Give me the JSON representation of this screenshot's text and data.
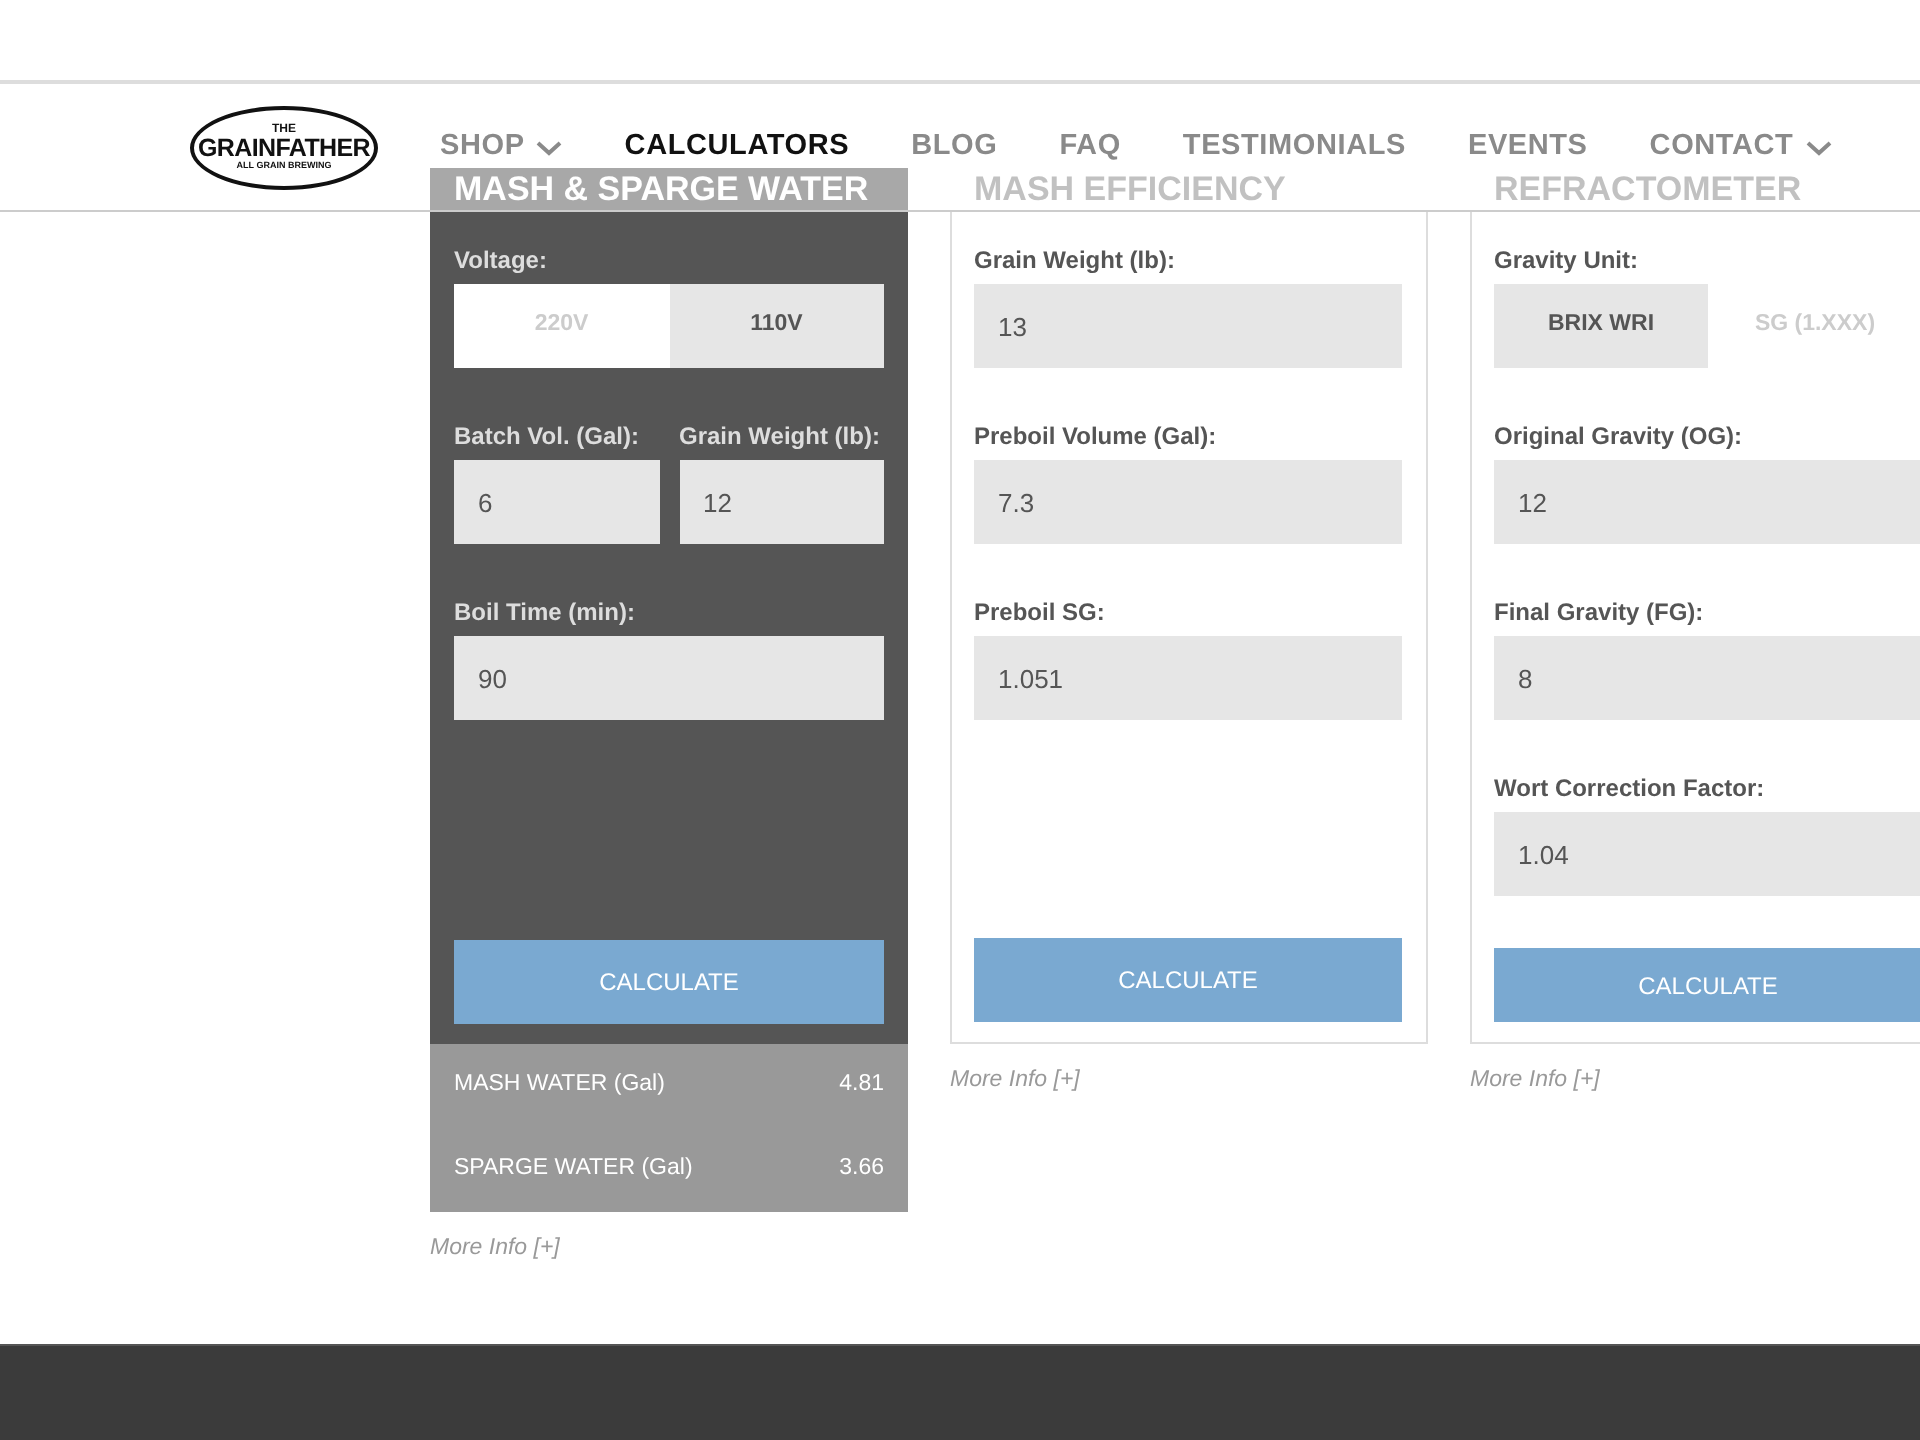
{
  "logo": {
    "top": "THE",
    "main": "GRAINFATHER",
    "sub": "ALL GRAIN BREWING"
  },
  "nav": [
    {
      "label": "SHOP",
      "dropdown": true,
      "selected": false
    },
    {
      "label": "CALCULATORS",
      "dropdown": false,
      "selected": true
    },
    {
      "label": "BLOG",
      "dropdown": false,
      "selected": false
    },
    {
      "label": "FAQ",
      "dropdown": false,
      "selected": false
    },
    {
      "label": "TESTIMONIALS",
      "dropdown": false,
      "selected": false
    },
    {
      "label": "EVENTS",
      "dropdown": false,
      "selected": false
    },
    {
      "label": "CONTACT",
      "dropdown": true,
      "selected": false
    }
  ],
  "calculators": [
    {
      "title": "MASH & SPARGE WATER",
      "selected": true,
      "rows": [
        [
          {
            "kind": "toggle",
            "label": "Voltage:",
            "options": [
              {
                "label": "220V",
                "selected": false
              },
              {
                "label": "110V",
                "selected": true
              }
            ]
          }
        ],
        [
          {
            "kind": "input",
            "label": "Batch Vol. (Gal):",
            "value": "6"
          },
          {
            "kind": "input",
            "label": "Grain Weight (lb):",
            "value": "12"
          }
        ],
        [
          {
            "kind": "input",
            "label": "Boil Time (min):",
            "value": "90"
          }
        ]
      ],
      "button": "CALCULATE",
      "results": [
        {
          "label": "MASH WATER (Gal)",
          "value": "4.81"
        },
        {
          "label": "SPARGE WATER (Gal)",
          "value": "3.66"
        }
      ],
      "more_info": "More Info [+]"
    },
    {
      "title": "MASH EFFICIENCY",
      "selected": false,
      "rows": [
        [
          {
            "kind": "input",
            "label": "Grain Weight (lb):",
            "value": "13"
          }
        ],
        [
          {
            "kind": "input",
            "label": "Preboil Volume (Gal):",
            "value": "7.3"
          }
        ],
        [
          {
            "kind": "input",
            "label": "Preboil SG:",
            "value": "1.051"
          }
        ]
      ],
      "button": "CALCULATE",
      "more_info": "More Info [+]"
    },
    {
      "title": "REFRACTOMETER",
      "selected": false,
      "rows": [
        [
          {
            "kind": "toggle",
            "label": "Gravity Unit:",
            "options": [
              {
                "label": "BRIX WRI",
                "selected": true
              },
              {
                "label": "SG (1.XXX)",
                "selected": false
              }
            ]
          }
        ],
        [
          {
            "kind": "input",
            "label": "Original Gravity (OG):",
            "value": "12"
          }
        ],
        [
          {
            "kind": "input",
            "label": "Final Gravity (FG):",
            "value": "8"
          }
        ],
        [
          {
            "kind": "input",
            "label": "Wort Correction Factor:",
            "value": "1.04"
          }
        ]
      ],
      "button": "CALCULATE",
      "more_info": "More Info [+]"
    }
  ]
}
